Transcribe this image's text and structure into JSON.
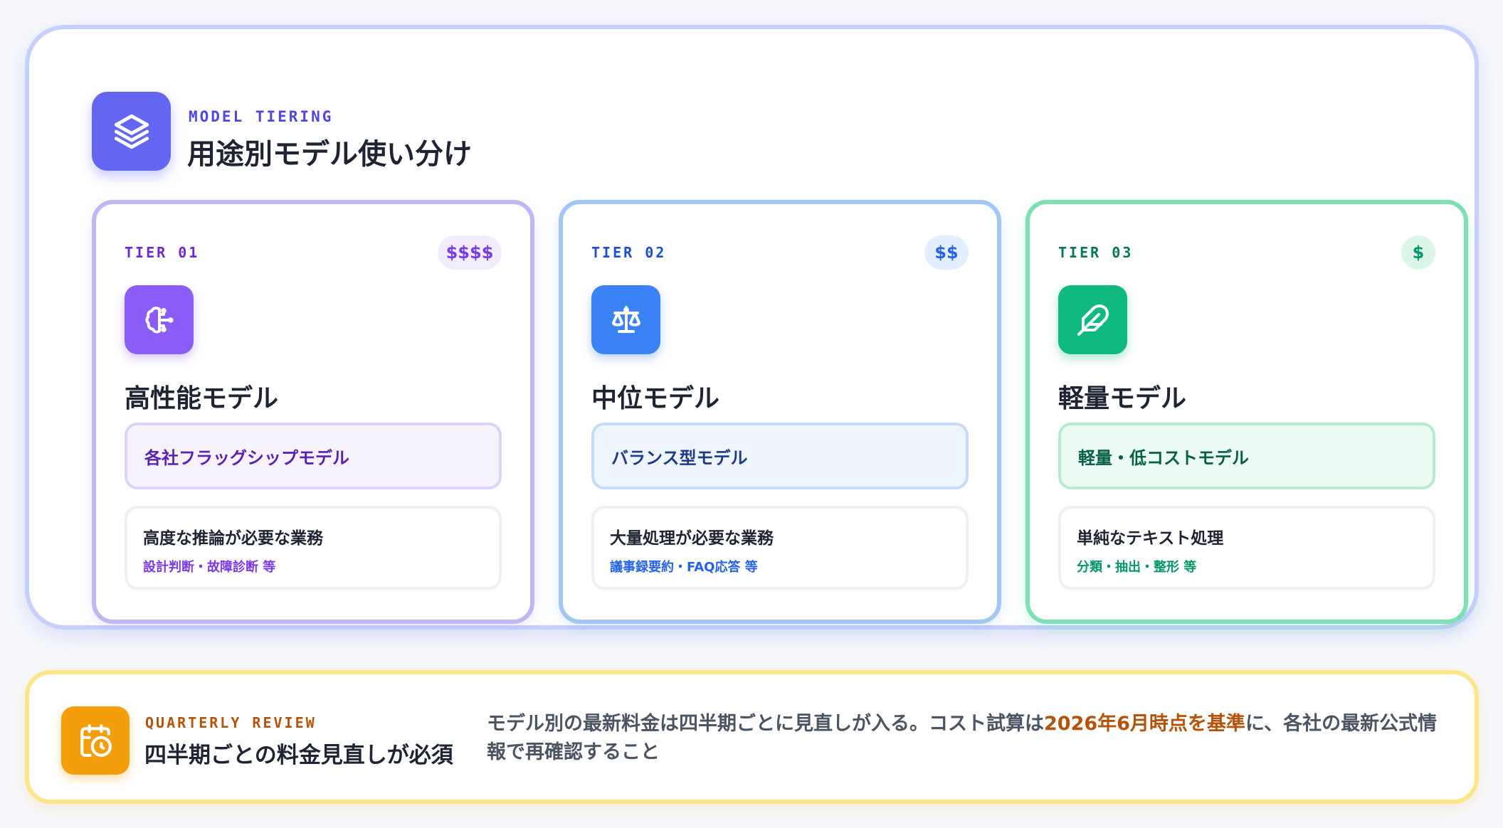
{
  "header": {
    "eyebrow": "MODEL TIERING",
    "title": "用途別モデル使い分け",
    "icon": "layers-icon"
  },
  "tiers": [
    {
      "label": "TIER 01",
      "cost": "$$$$",
      "icon": "brain-icon",
      "name": "高性能モデル",
      "model_type": "各社フラッグシップモデル",
      "usecase_title": "高度な推論が必要な業務",
      "usecase_examples": "設計判断・故障診断 等",
      "accent": "#8b5cf6"
    },
    {
      "label": "TIER 02",
      "cost": "$$",
      "icon": "scale-icon",
      "name": "中位モデル",
      "model_type": "バランス型モデル",
      "usecase_title": "大量処理が必要な業務",
      "usecase_examples": "議事録要約・FAQ応答 等",
      "accent": "#3b82f6"
    },
    {
      "label": "TIER 03",
      "cost": "$",
      "icon": "feather-icon",
      "name": "軽量モデル",
      "model_type": "軽量・低コストモデル",
      "usecase_title": "単純なテキスト処理",
      "usecase_examples": "分類・抽出・整形 等",
      "accent": "#10b981"
    }
  ],
  "review": {
    "eyebrow": "QUARTERLY REVIEW",
    "title": "四半期ごとの料金見直しが必須",
    "text_before": "モデル別の最新料金は四半期ごとに見直しが入る。コスト試算は",
    "text_highlight": "2026年6月時点を基準",
    "text_after": "に、各社の最新公式情報で再確認すること",
    "icon": "calendar-clock-icon",
    "accent": "#f59e0b"
  }
}
